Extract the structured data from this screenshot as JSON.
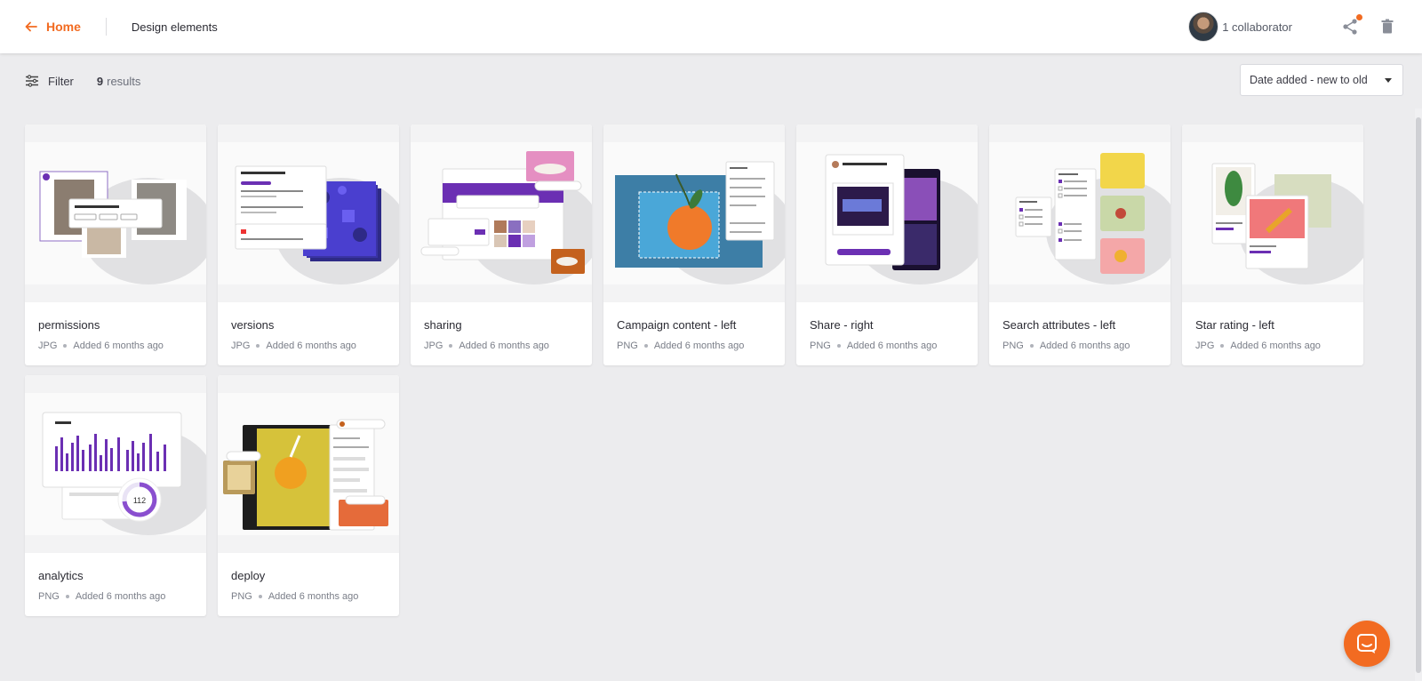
{
  "header": {
    "home_label": "Home",
    "breadcrumb": "Design elements",
    "collaborators": "1 collaborator"
  },
  "toolbar": {
    "filter_label": "Filter",
    "results_count": "9",
    "results_label": "results",
    "sort_value": "Date added - new to old"
  },
  "colors": {
    "accent": "#f26b21",
    "purple": "#6b2fb3"
  },
  "files": [
    {
      "name": "permissions",
      "type": "JPG",
      "added": "Added 6 months ago"
    },
    {
      "name": "versions",
      "type": "JPG",
      "added": "Added 6 months ago"
    },
    {
      "name": "sharing",
      "type": "JPG",
      "added": "Added 6 months ago"
    },
    {
      "name": "Campaign content - left",
      "type": "PNG",
      "added": "Added 6 months ago"
    },
    {
      "name": "Share - right",
      "type": "PNG",
      "added": "Added 6 months ago"
    },
    {
      "name": "Search attributes - left",
      "type": "PNG",
      "added": "Added 6 months ago"
    },
    {
      "name": "Star rating - left",
      "type": "JPG",
      "added": "Added 6 months ago"
    },
    {
      "name": "analytics",
      "type": "PNG",
      "added": "Added 6 months ago"
    },
    {
      "name": "deploy",
      "type": "PNG",
      "added": "Added 6 months ago"
    }
  ],
  "thumbnail_text": {
    "analytics_value": "112"
  }
}
